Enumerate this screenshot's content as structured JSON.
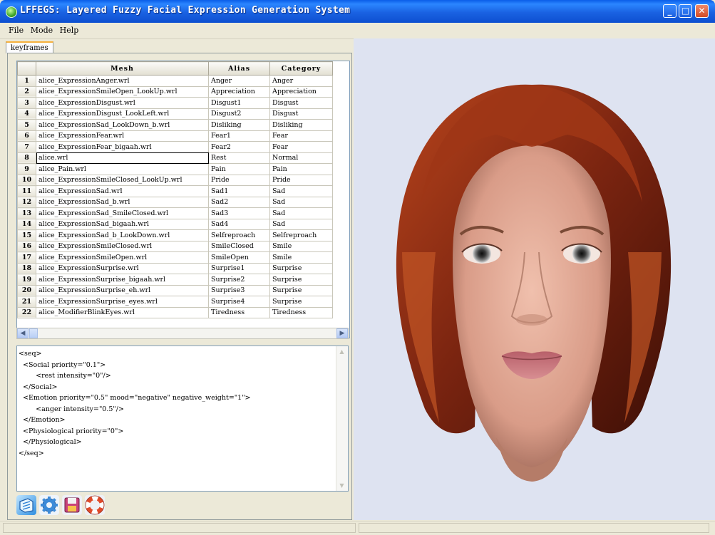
{
  "window": {
    "title": "LFFEGS: Layered Fuzzy Facial Expression Generation System",
    "controls": {
      "minimize": "_",
      "maximize": "□",
      "close": "✕"
    }
  },
  "menu": [
    "File",
    "Mode",
    "Help"
  ],
  "tabs": [
    "keyframes"
  ],
  "table": {
    "headers": {
      "index": "",
      "mesh": "Mesh",
      "alias": "Alias",
      "category": "Category"
    },
    "selected_row": 8,
    "rows": [
      {
        "n": "1",
        "mesh": "alice_ExpressionAnger.wrl",
        "alias": "Anger",
        "category": "Anger"
      },
      {
        "n": "2",
        "mesh": "alice_ExpressionSmileOpen_LookUp.wrl",
        "alias": "Appreciation",
        "category": "Appreciation"
      },
      {
        "n": "3",
        "mesh": "alice_ExpressionDisgust.wrl",
        "alias": "Disgust1",
        "category": "Disgust"
      },
      {
        "n": "4",
        "mesh": "alice_ExpressionDisgust_LookLeft.wrl",
        "alias": "Disgust2",
        "category": "Disgust"
      },
      {
        "n": "5",
        "mesh": "alice_ExpressionSad_LookDown_b.wrl",
        "alias": "Disliking",
        "category": "Disliking"
      },
      {
        "n": "6",
        "mesh": "alice_ExpressionFear.wrl",
        "alias": "Fear1",
        "category": "Fear"
      },
      {
        "n": "7",
        "mesh": "alice_ExpressionFear_bigaah.wrl",
        "alias": "Fear2",
        "category": "Fear"
      },
      {
        "n": "8",
        "mesh": "alice.wrl",
        "alias": "Rest",
        "category": "Normal"
      },
      {
        "n": "9",
        "mesh": "alice_Pain.wrl",
        "alias": "Pain",
        "category": "Pain"
      },
      {
        "n": "10",
        "mesh": "alice_ExpressionSmileClosed_LookUp.wrl",
        "alias": "Pride",
        "category": "Pride"
      },
      {
        "n": "11",
        "mesh": "alice_ExpressionSad.wrl",
        "alias": "Sad1",
        "category": "Sad"
      },
      {
        "n": "12",
        "mesh": "alice_ExpressionSad_b.wrl",
        "alias": "Sad2",
        "category": "Sad"
      },
      {
        "n": "13",
        "mesh": "alice_ExpressionSad_SmileClosed.wrl",
        "alias": "Sad3",
        "category": "Sad"
      },
      {
        "n": "14",
        "mesh": "alice_ExpressionSad_bigaah.wrl",
        "alias": "Sad4",
        "category": "Sad"
      },
      {
        "n": "15",
        "mesh": "alice_ExpressionSad_b_LookDown.wrl",
        "alias": "Selfreproach",
        "category": "Selfreproach"
      },
      {
        "n": "16",
        "mesh": "alice_ExpressionSmileClosed.wrl",
        "alias": "SmileClosed",
        "category": "Smile"
      },
      {
        "n": "17",
        "mesh": "alice_ExpressionSmileOpen.wrl",
        "alias": "SmileOpen",
        "category": "Smile"
      },
      {
        "n": "18",
        "mesh": "alice_ExpressionSurprise.wrl",
        "alias": "Surprise1",
        "category": "Surprise"
      },
      {
        "n": "19",
        "mesh": "alice_ExpressionSurprise_bigaah.wrl",
        "alias": "Surprise2",
        "category": "Surprise"
      },
      {
        "n": "20",
        "mesh": "alice_ExpressionSurprise_eh.wrl",
        "alias": "Surprise3",
        "category": "Surprise"
      },
      {
        "n": "21",
        "mesh": "alice_ExpressionSurprise_eyes.wrl",
        "alias": "Surprise4",
        "category": "Surprise"
      },
      {
        "n": "22",
        "mesh": "alice_ModifierBlinkEyes.wrl",
        "alias": "Tiredness",
        "category": "Tiredness"
      }
    ]
  },
  "script_lines": [
    "<seq>",
    "  <Social priority=\"0.1\">",
    "        <rest intensity=\"0\"/>",
    "  </Social>",
    "  <Emotion priority=\"0.5\" mood=\"negative\" negative_weight=\"1\">",
    "        <anger intensity=\"0.5\"/>",
    "  </Emotion>",
    "  <Physiological priority=\"0\">",
    "  </Physiological>",
    "</seq>"
  ],
  "toolbar_icons": [
    "open-icon",
    "settings-gear-icon",
    "save-disk-icon",
    "help-lifebuoy-icon"
  ],
  "colors": {
    "title_blue": "#1a62e2",
    "viewport_bg": "#dee3f1",
    "hair": "#8a2a12",
    "skin": "#e2ab98"
  }
}
